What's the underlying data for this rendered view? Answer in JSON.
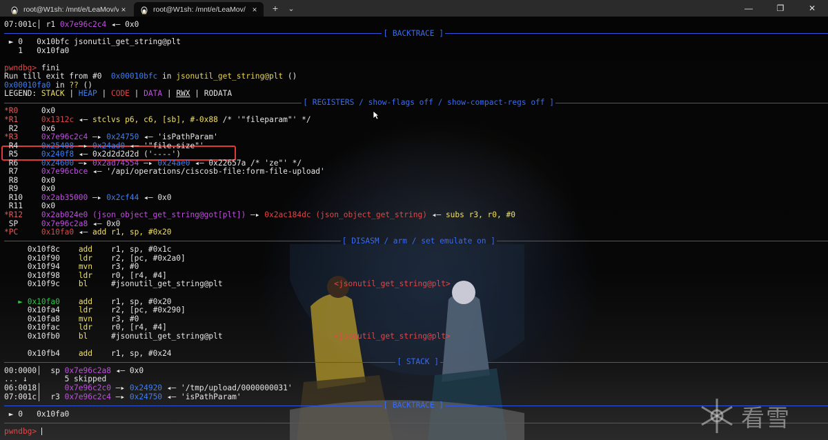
{
  "tabs": [
    {
      "title": "root@W1sh: /mnt/e/LeaMov/v",
      "icon": "linux-tux-icon",
      "close": "×"
    },
    {
      "title": "root@W1sh: /mnt/e/LeaMov/",
      "icon": "linux-tux-icon",
      "close": "×"
    }
  ],
  "tabbar": {
    "new_tab": "+",
    "dropdown": "⌄"
  },
  "window": {
    "minimize": "—",
    "maximize": "❐",
    "close": "✕"
  },
  "terminal": {
    "l01": {
      "a": "07:001c│",
      "b": " r1 ",
      "c": "0x7e96c2c4",
      "d": " ◂— 0x0"
    },
    "sep_backtrace1": "[ BACKTRACE ]",
    "l03": {
      "a": " ► 0   0x10bfc jsonutil_get_string@plt"
    },
    "l04": {
      "a": "   1   0x10fa0"
    },
    "l06": {
      "a": "pwndbg>",
      "b": " fini"
    },
    "l07": {
      "a": "Run till exit from #0  ",
      "b": "0x00010bfc",
      "c": " in ",
      "d": "jsonutil_get_string@plt",
      "e": " ()"
    },
    "l08": {
      "a": "0x00010fa0",
      "b": " in ",
      "c": "??",
      "d": " ()"
    },
    "l09": {
      "a": "LEGEND: ",
      "b": "STACK",
      "c": " | ",
      "d": "HEAP",
      "e": " | ",
      "f": "CODE",
      "g": " | ",
      "h": "DATA",
      "i": " | ",
      "j": "RWX",
      "k": " | RODATA"
    },
    "sep_registers": "[ REGISTERS / show-flags off / show-compact-regs off ]",
    "reg_r0": {
      "a": "*R0 ",
      "b": "    0x0"
    },
    "reg_r1": {
      "a": "*R1 ",
      "b": "    ",
      "c": "0x1312c",
      "d": " ◂— ",
      "e": "stclvs p6, c6, [sb], #-0x88",
      "f": " /* '\"fileparam\"' */"
    },
    "reg_r2": {
      "a": " R2 ",
      "b": "    0x6"
    },
    "reg_r3": {
      "a": "*R3 ",
      "b": "    ",
      "c": "0x7e96c2c4",
      "d": " —▸ ",
      "e": "0x24750",
      "f": " ◂— 'isPathParam'"
    },
    "reg_r4": {
      "a": " R4 ",
      "b": "    ",
      "c": "0x25408",
      "d": " —▸ ",
      "e": "0x24ad0",
      "f": " ◂— '\"file.size\"'"
    },
    "reg_r5": {
      "a": " R5 ",
      "b": "    ",
      "c": "0x240f8",
      "d": " ◂— 0x2d2d2d2d ('----')"
    },
    "reg_r6": {
      "a": " R6 ",
      "b": "    ",
      "c": "0x24600",
      "d": " —▸ ",
      "e": "0x2ad74554",
      "f": " —▸ ",
      "g": "0x24ae0",
      "h": " ◂— 0x22657a /* 'ze\"' */"
    },
    "reg_r7": {
      "a": " R7 ",
      "b": "    ",
      "c": "0x7e96cbce",
      "d": " ◂— '/api/operations/ciscosb-file:form-file-upload'"
    },
    "reg_r8": {
      "a": " R8 ",
      "b": "    0x0"
    },
    "reg_r9": {
      "a": " R9 ",
      "b": "    0x0"
    },
    "reg_r10": {
      "a": " R10",
      "b": "    ",
      "c": "0x2ab35000",
      "d": " —▸ ",
      "e": "0x2cf44",
      "f": " ◂— 0x0"
    },
    "reg_r11": {
      "a": " R11",
      "b": "    0x0"
    },
    "reg_r12": {
      "a": "*R12",
      "b": "    ",
      "c": "0x2ab024e0 (json_object_get_string@got[plt])",
      "d": " —▸ ",
      "e": "0x2ac184dc (json_object_get_string)",
      "f": " ◂— ",
      "g": "subs r3, r0, #0"
    },
    "reg_sp": {
      "a": " SP ",
      "b": "    ",
      "c": "0x7e96c2a8",
      "d": " ◂— 0x0"
    },
    "reg_pc": {
      "a": "*PC ",
      "b": "    ",
      "c": "0x10fa0",
      "d": " ◂— ",
      "e": "add r1, sp, #0x20"
    },
    "sep_disasm": "[ DISASM / arm / set emulate on ]",
    "dis": [
      {
        "mark": "   ",
        "addr": "0x10f8c",
        "op": "add",
        "args": "r1, sp, #0x1c",
        "extra": ""
      },
      {
        "mark": "   ",
        "addr": "0x10f90",
        "op": "ldr",
        "args": "r2, [pc, #0x2a0]",
        "extra": ""
      },
      {
        "mark": "   ",
        "addr": "0x10f94",
        "op": "mvn",
        "args": "r3, #0",
        "extra": ""
      },
      {
        "mark": "   ",
        "addr": "0x10f98",
        "op": "ldr",
        "args": "r0, [r4, #4]",
        "extra": ""
      },
      {
        "mark": "   ",
        "addr": "0x10f9c",
        "op": "bl",
        "args": "#jsonutil_get_string@plt",
        "extra": "<jsonutil_get_string@plt>"
      },
      {
        "mark": "",
        "addr": "",
        "op": "",
        "args": "",
        "extra": ""
      },
      {
        "mark": " ► ",
        "addr": "0x10fa0",
        "op": "add",
        "args": "r1, sp, #0x20",
        "extra": ""
      },
      {
        "mark": "   ",
        "addr": "0x10fa4",
        "op": "ldr",
        "args": "r2, [pc, #0x290]",
        "extra": ""
      },
      {
        "mark": "   ",
        "addr": "0x10fa8",
        "op": "mvn",
        "args": "r3, #0",
        "extra": ""
      },
      {
        "mark": "   ",
        "addr": "0x10fac",
        "op": "ldr",
        "args": "r0, [r4, #4]",
        "extra": ""
      },
      {
        "mark": "   ",
        "addr": "0x10fb0",
        "op": "bl",
        "args": "#jsonutil_get_string@plt",
        "extra": "<jsonutil_get_string@plt>"
      },
      {
        "mark": "",
        "addr": "",
        "op": "",
        "args": "",
        "extra": ""
      },
      {
        "mark": "   ",
        "addr": "0x10fb4",
        "op": "add",
        "args": "r1, sp, #0x24",
        "extra": ""
      }
    ],
    "sep_stack": "[ STACK ]",
    "st1": {
      "a": "00:0000│",
      "b": "  sp ",
      "c": "0x7e96c2a8",
      "d": " ◂— 0x0"
    },
    "st2": {
      "a": "... ↓",
      "b": "        5 skipped"
    },
    "st3": {
      "a": "06:0018│",
      "b": "     ",
      "c": "0x7e96c2c0",
      "d": " —▸ ",
      "e": "0x24920",
      "f": " ◂— '/tmp/upload/0000000031'"
    },
    "st4": {
      "a": "07:001c│",
      "b": "  r3 ",
      "c": "0x7e96c2c4",
      "d": " —▸ ",
      "e": "0x24750",
      "f": " ◂— 'isPathParam'"
    },
    "sep_backtrace2": "[ BACKTRACE ]",
    "bt2": {
      "a": " ► 0   0x10fa0"
    },
    "prompt": {
      "a": "pwndbg>",
      "b": " "
    }
  },
  "watermark": {
    "text": "看雪"
  }
}
